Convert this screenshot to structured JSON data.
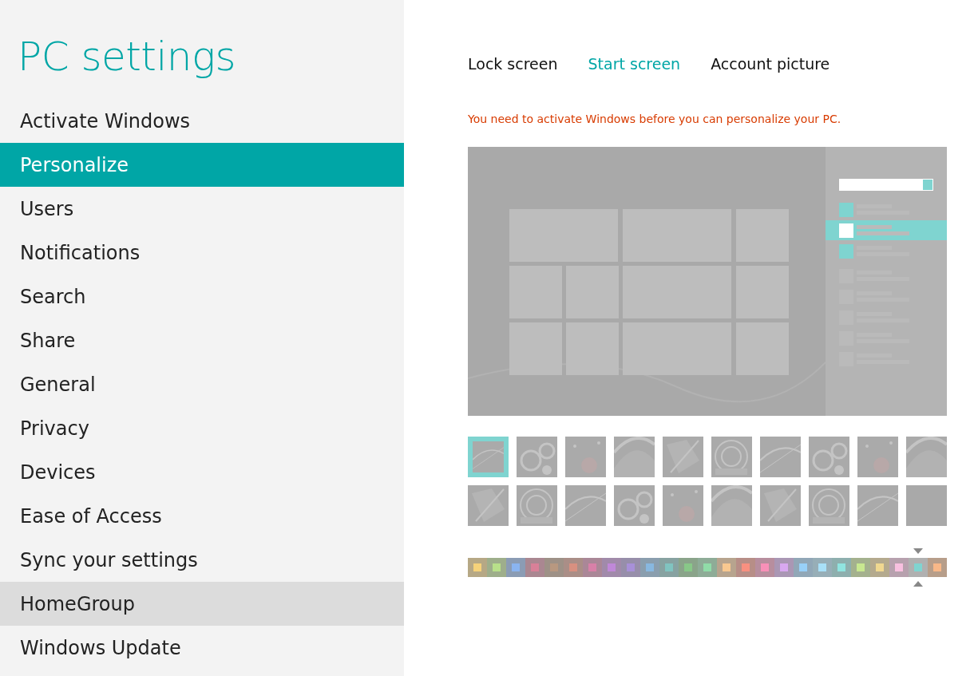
{
  "sidebar": {
    "title": "PC settings",
    "items": [
      {
        "label": "Activate Windows",
        "selected": false,
        "hovered": false
      },
      {
        "label": "Personalize",
        "selected": true,
        "hovered": false
      },
      {
        "label": "Users",
        "selected": false,
        "hovered": false
      },
      {
        "label": "Notifications",
        "selected": false,
        "hovered": false
      },
      {
        "label": "Search",
        "selected": false,
        "hovered": false
      },
      {
        "label": "Share",
        "selected": false,
        "hovered": false
      },
      {
        "label": "General",
        "selected": false,
        "hovered": false
      },
      {
        "label": "Privacy",
        "selected": false,
        "hovered": false
      },
      {
        "label": "Devices",
        "selected": false,
        "hovered": false
      },
      {
        "label": "Ease of Access",
        "selected": false,
        "hovered": false
      },
      {
        "label": "Sync your settings",
        "selected": false,
        "hovered": false
      },
      {
        "label": "HomeGroup",
        "selected": false,
        "hovered": true
      },
      {
        "label": "Windows Update",
        "selected": false,
        "hovered": false
      }
    ]
  },
  "tabs": [
    {
      "label": "Lock screen",
      "selected": false
    },
    {
      "label": "Start screen",
      "selected": true
    },
    {
      "label": "Account picture",
      "selected": false
    }
  ],
  "warning": "You need to activate Windows before you can personalize your PC.",
  "patterns": [
    {
      "kind": "picture",
      "selected": true
    },
    {
      "kind": "picture",
      "selected": false
    },
    {
      "kind": "picture",
      "selected": false
    },
    {
      "kind": "picture",
      "selected": false
    },
    {
      "kind": "picture",
      "selected": false
    },
    {
      "kind": "picture",
      "selected": false
    },
    {
      "kind": "picture",
      "selected": false
    },
    {
      "kind": "picture",
      "selected": false
    },
    {
      "kind": "picture",
      "selected": false
    },
    {
      "kind": "picture",
      "selected": false
    },
    {
      "kind": "picture",
      "selected": false
    },
    {
      "kind": "picture",
      "selected": false
    },
    {
      "kind": "picture",
      "selected": false
    },
    {
      "kind": "picture",
      "selected": false
    },
    {
      "kind": "picture",
      "selected": false
    },
    {
      "kind": "picture",
      "selected": false
    },
    {
      "kind": "picture",
      "selected": false
    },
    {
      "kind": "picture",
      "selected": false
    },
    {
      "kind": "picture",
      "selected": false
    },
    {
      "kind": "plain",
      "selected": false
    }
  ],
  "colors": [
    {
      "color": "#f5d27a",
      "selected": false
    },
    {
      "color": "#b8e08a",
      "selected": false
    },
    {
      "color": "#8ab4f0",
      "selected": false
    },
    {
      "color": "#d88098",
      "selected": false
    },
    {
      "color": "#b89880",
      "selected": false
    },
    {
      "color": "#d89080",
      "selected": false
    },
    {
      "color": "#d880a8",
      "selected": false
    },
    {
      "color": "#c088d8",
      "selected": false
    },
    {
      "color": "#a890d8",
      "selected": false
    },
    {
      "color": "#88b8e0",
      "selected": false
    },
    {
      "color": "#80c4c0",
      "selected": false
    },
    {
      "color": "#88c888",
      "selected": false
    },
    {
      "color": "#90dca8",
      "selected": false
    },
    {
      "color": "#f8c890",
      "selected": false
    },
    {
      "color": "#f89080",
      "selected": false
    },
    {
      "color": "#f890b8",
      "selected": false
    },
    {
      "color": "#d8a8f0",
      "selected": false
    },
    {
      "color": "#98d0f8",
      "selected": false
    },
    {
      "color": "#a8e0f8",
      "selected": false
    },
    {
      "color": "#90e4e0",
      "selected": false
    },
    {
      "color": "#c8e890",
      "selected": false
    },
    {
      "color": "#f0d890",
      "selected": false
    },
    {
      "color": "#f8c0e0",
      "selected": false
    },
    {
      "color": "#80d4d0",
      "selected": true
    },
    {
      "color": "#f8b888",
      "selected": false
    }
  ]
}
